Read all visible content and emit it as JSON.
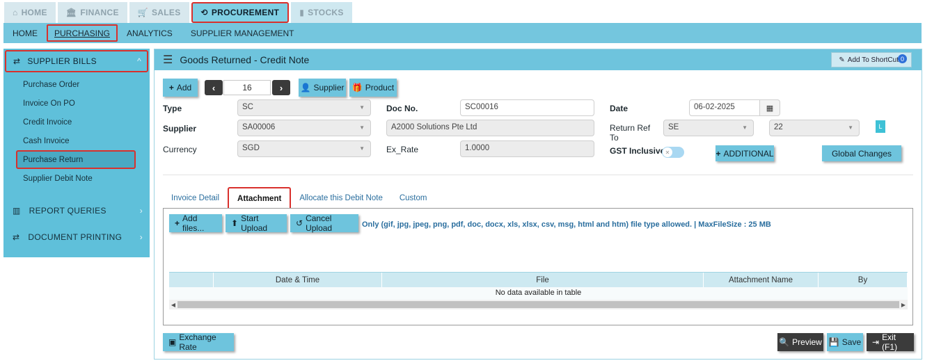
{
  "top_tabs": [
    {
      "label": "HOME",
      "icon": "home-icon"
    },
    {
      "label": "FINANCE",
      "icon": "bank-icon"
    },
    {
      "label": "SALES",
      "icon": "cart-icon"
    },
    {
      "label": "PROCUREMENT",
      "icon": "procurement-icon",
      "active": true
    },
    {
      "label": "STOCKS",
      "icon": "bar-chart-icon"
    }
  ],
  "sub_nav": [
    {
      "label": "HOME"
    },
    {
      "label": "PURCHASING",
      "active": true
    },
    {
      "label": "ANALYTICS"
    },
    {
      "label": "SUPPLIER MANAGEMENT"
    }
  ],
  "sidebar": {
    "header": "SUPPLIER BILLS",
    "items": [
      "Purchase Order",
      "Invoice On PO",
      "Credit Invoice",
      "Cash Invoice",
      "Purchase Return",
      "Supplier Debit Note"
    ],
    "active_item": "Purchase Return",
    "sections": [
      "REPORT QUERIES",
      "DOCUMENT PRINTING"
    ]
  },
  "main": {
    "title": "Goods Returned - Credit Note",
    "shortcut_label": "Add To ShortCut",
    "shortcut_count": "0"
  },
  "toolbar": {
    "add_label": "Add",
    "record_number": "16",
    "supplier_label": "Supplier",
    "product_label": "Product"
  },
  "form": {
    "type_label": "Type",
    "type_value": "SC",
    "supplier_label": "Supplier",
    "supplier_value": "SA00006",
    "currency_label": "Currency",
    "currency_value": "SGD",
    "docno_label": "Doc No.",
    "docno_value": "SC00016",
    "supplier_name_value": "A2000 Solutions Pte Ltd",
    "exrate_label": "Ex_Rate",
    "exrate_value": "1.0000",
    "date_label": "Date",
    "date_value": "06-02-2025",
    "return_ref_label_1": "Return Ref",
    "return_ref_label_2": "To",
    "return_ref_value_1": "SE",
    "return_ref_value_2": "22",
    "gst_label": "GST Inclusive",
    "l_badge": "L",
    "additional_label": "ADDITIONAL",
    "global_changes_label": "Global Changes"
  },
  "tabs": [
    {
      "label": "Invoice Detail"
    },
    {
      "label": "Attachment",
      "active": true
    },
    {
      "label": "Allocate this Debit Note"
    },
    {
      "label": "Custom"
    }
  ],
  "attachment": {
    "add_files_label": "Add files...",
    "start_upload_label": "Start Upload",
    "cancel_upload_label": "Cancel Upload",
    "file_note": "Only (gif, jpg, jpeg, png, pdf, doc, docx, xls, xlsx, csv, msg, html and htm) file type allowed. | MaxFileSize : 25 MB",
    "columns": [
      "",
      "Date & Time",
      "File",
      "Attachment Name",
      "By"
    ],
    "empty_text": "No data available in table"
  },
  "footer": {
    "exchange_rate_label": "Exchange Rate",
    "preview_label": "Preview",
    "save_label": "Save",
    "exit_label": "Exit (F1)"
  }
}
